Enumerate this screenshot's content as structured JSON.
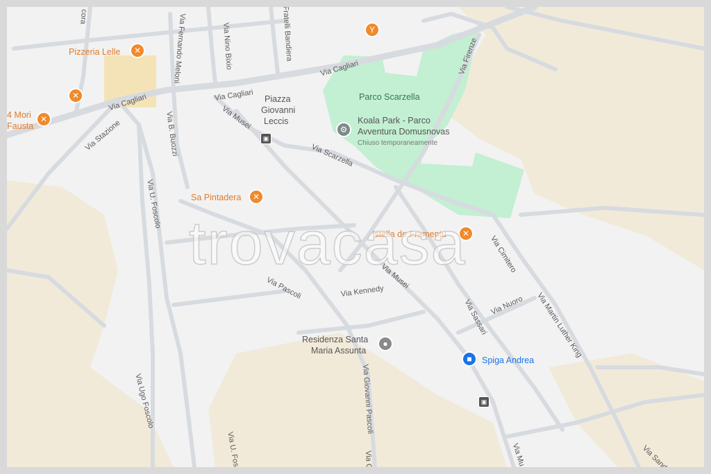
{
  "watermark": "trovacasa",
  "colors": {
    "background": "#f2f2f2",
    "sand": "#f2ead9",
    "park": "#c3efd3",
    "road": "#d7dbe0",
    "poi_orange": "#f08a2c",
    "poi_blue": "#1a73e8"
  },
  "streets": {
    "via_cagliari_1": "Via Cagliari",
    "via_cagliari_2": "Via Cagliari",
    "via_cagliari_3": "Via Cagliari",
    "via_stazione": "Via Stazione",
    "via_fernando_meloni": "Via Fernando Meloni",
    "via_nino_bixio": "Via Nino Bixio",
    "fratelli_bandiera": "Fratelli Bandiera",
    "via_firenze": "Via Firenze",
    "via_b_buozzi": "Via B. Buozzi",
    "via_musei_1": "Via Musei",
    "via_musei_2": "Via Musei",
    "via_scarzella": "Via Scarzella",
    "via_u_foscolo": "Via U. Foscolo",
    "via_ugo_foscolo": "Via Ugo Foscolo",
    "via_u_fos": "Via U. Fos",
    "via_pascoli": "Via Pascoli",
    "via_kennedy": "Via Kennedy",
    "via_giovanni_pascoli": "Via Giovanni Pascoli",
    "via_gi": "Via Gi",
    "via_sassari": "Via Sassari",
    "via_nuoro": "Via Nuoro",
    "via_cimitero": "Via Cimitero",
    "via_martin_luther_king": "Via Martin Luther King",
    "via_sand": "Via Sand",
    "via_mu": "Via Mu",
    "cora": "cora"
  },
  "places": {
    "pizzeria_lelle": "Pizzeria Lelle",
    "mori_line1": "4 Mori",
    "mori_line2": "Fausta",
    "piazza_line1": "Piazza",
    "piazza_line2": "Giovanni",
    "piazza_line3": "Leccis",
    "parco_scarzella": "Parco Scarzella",
    "koala_line1": "Koala Park - Parco",
    "koala_line2": "Avventura Domusnovas",
    "koala_status": "Chiuso temporaneamente",
    "sa_pintadera": "Sa Pintadera",
    "istella": "Istella de Framentu",
    "residenza_line1": "Residenza Santa",
    "residenza_line2": "Maria Assunta",
    "spiga_andrea": "Spiga Andrea"
  },
  "icons": {
    "restaurant": "fork-knife-icon",
    "bar": "cocktail-icon",
    "park": "park-icon",
    "place": "place-pin-icon",
    "shop": "shopping-bag-icon",
    "bus": "bus-stop-icon"
  }
}
